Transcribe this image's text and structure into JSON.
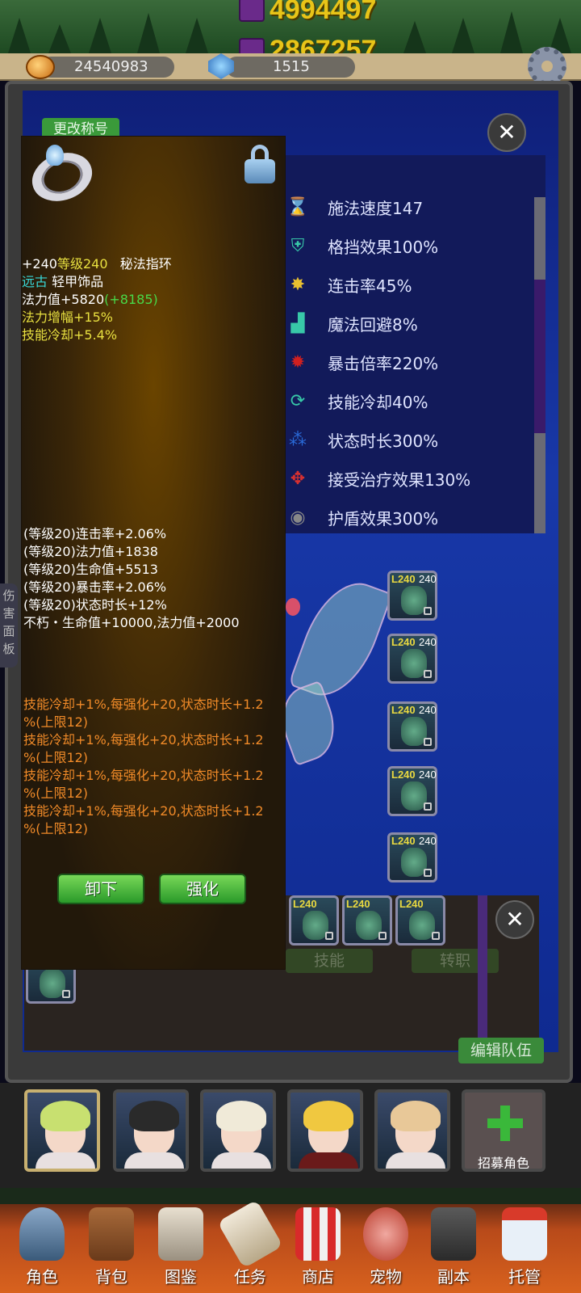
{
  "currency": {
    "top_value_1": "4994497",
    "top_value_2": "2867257",
    "gold": "24540983",
    "gems": "1515"
  },
  "panel": {
    "rename_label": "更改称号",
    "close_symbol": "✕"
  },
  "stats": [
    {
      "label": "施法速度147",
      "icon": "hourglass-icon",
      "color": "#e07a28"
    },
    {
      "label": "格挡效果100%",
      "icon": "shield-icon",
      "color": "#38c8a8"
    },
    {
      "label": "连击率45%",
      "icon": "star-burst-icon",
      "color": "#e8c030"
    },
    {
      "label": "魔法回避8%",
      "icon": "boot-icon",
      "color": "#38c8a8"
    },
    {
      "label": "暴击倍率220%",
      "icon": "blood-splash-icon",
      "color": "#d02020"
    },
    {
      "label": "技能冷却40%",
      "icon": "cooldown-icon",
      "color": "#38c8a8"
    },
    {
      "label": "状态时长300%",
      "icon": "buff-icon",
      "color": "#2a6ad8"
    },
    {
      "label": "接受治疗效果130%",
      "icon": "cross-arrows-icon",
      "color": "#d83030"
    },
    {
      "label": "护盾效果300%",
      "icon": "shield-orb-icon",
      "color": "#888888"
    }
  ],
  "equipment": {
    "slots_right": [
      {
        "level": "L240",
        "plus": "240"
      },
      {
        "level": "L240",
        "plus": "240"
      },
      {
        "level": "L240",
        "plus": "240"
      },
      {
        "level": "L240",
        "plus": "240"
      },
      {
        "level": "L240",
        "plus": "240"
      }
    ],
    "slots_bottom": [
      {
        "level": "L240"
      },
      {
        "level": "L240"
      },
      {
        "level": "L240"
      }
    ]
  },
  "lower": {
    "tab_skill": "技能",
    "tab_job": "转职",
    "edit_team": "编辑队伍"
  },
  "side_tab": [
    "伤",
    "害",
    "面",
    "板"
  ],
  "tooltip": {
    "line1_plus": "+240",
    "line1_level": "等级240",
    "line1_name": "秘法指环",
    "line2_tier": "远古",
    "line2_type": "轻甲饰品",
    "line3_base": "法力值+5820",
    "line3_bonus": "(+8185)",
    "line4": "法力增幅+15%",
    "line5": "技能冷却+5.4%",
    "affixes": [
      "(等级20)连击率+2.06%",
      "(等级20)法力值+1838",
      "(等级20)生命值+5513",
      "(等级20)暴击率+2.06%",
      "(等级20)状态时长+12%",
      "不朽・生命值+10000,法力值+2000"
    ],
    "set_lines": [
      "技能冷却+1%,每强化+20,状态时长+1.2",
      "%(上限12)",
      "技能冷却+1%,每强化+20,状态时长+1.2",
      "%(上限12)",
      "技能冷却+1%,每强化+20,状态时长+1.2",
      "%(上限12)",
      "技能冷却+1%,每强化+20,状态时长+1.2",
      "%(上限12)"
    ],
    "unequip_label": "卸下",
    "enhance_label": "强化"
  },
  "roster": {
    "recruit_label": "招募角色"
  },
  "nav": [
    {
      "label": "角色",
      "icon": "helmet-icon"
    },
    {
      "label": "背包",
      "icon": "backpack-icon"
    },
    {
      "label": "图鉴",
      "icon": "book-icon"
    },
    {
      "label": "任务",
      "icon": "scroll-icon"
    },
    {
      "label": "商店",
      "icon": "shop-icon"
    },
    {
      "label": "宠物",
      "icon": "meat-icon"
    },
    {
      "label": "副本",
      "icon": "skull-gate-icon"
    },
    {
      "label": "托管",
      "icon": "calendar-icon"
    }
  ]
}
